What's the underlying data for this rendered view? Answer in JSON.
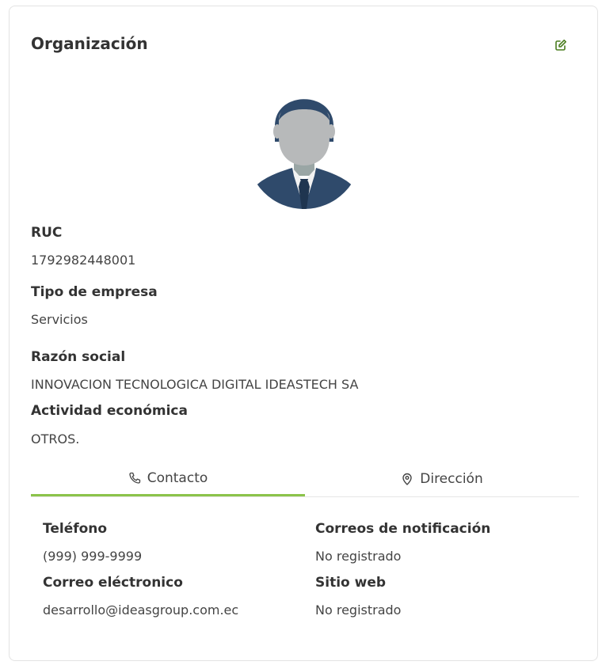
{
  "organization": {
    "title": "Organización",
    "edit_icon": "edit-icon",
    "avatar_icon": "avatar-businessman-icon",
    "fields": {
      "ruc_label": "RUC",
      "ruc_value": "1792982448001",
      "company_type_label": "Tipo de empresa",
      "company_type_value": "Servicios",
      "business_name_label": "Razón social",
      "business_name_value": "INNOVACION TECNOLOGICA DIGITAL IDEASTECH SA",
      "economic_activity_label": "Actividad económica",
      "economic_activity_value": "OTROS."
    }
  },
  "tabs": [
    {
      "label": "Contacto",
      "icon": "phone-icon",
      "active": true
    },
    {
      "label": "Dirección",
      "icon": "location-pin-icon",
      "active": false
    }
  ],
  "contact": {
    "phone_label": "Teléfono",
    "phone_value": "(999) 999-9999",
    "email_label": "Correo eléctronico",
    "email_value": "desarrollo@ideasgroup.com.ec",
    "notification_emails_label": "Correos de notificación",
    "notification_emails_value": "No registrado",
    "website_label": "Sitio web",
    "website_value": "No registrado"
  },
  "colors": {
    "accent": "#8bc34a",
    "edit_icon": "#4a7d1f",
    "avatar_suit": "#2f4a6b",
    "avatar_face": "#b7b9ba"
  }
}
